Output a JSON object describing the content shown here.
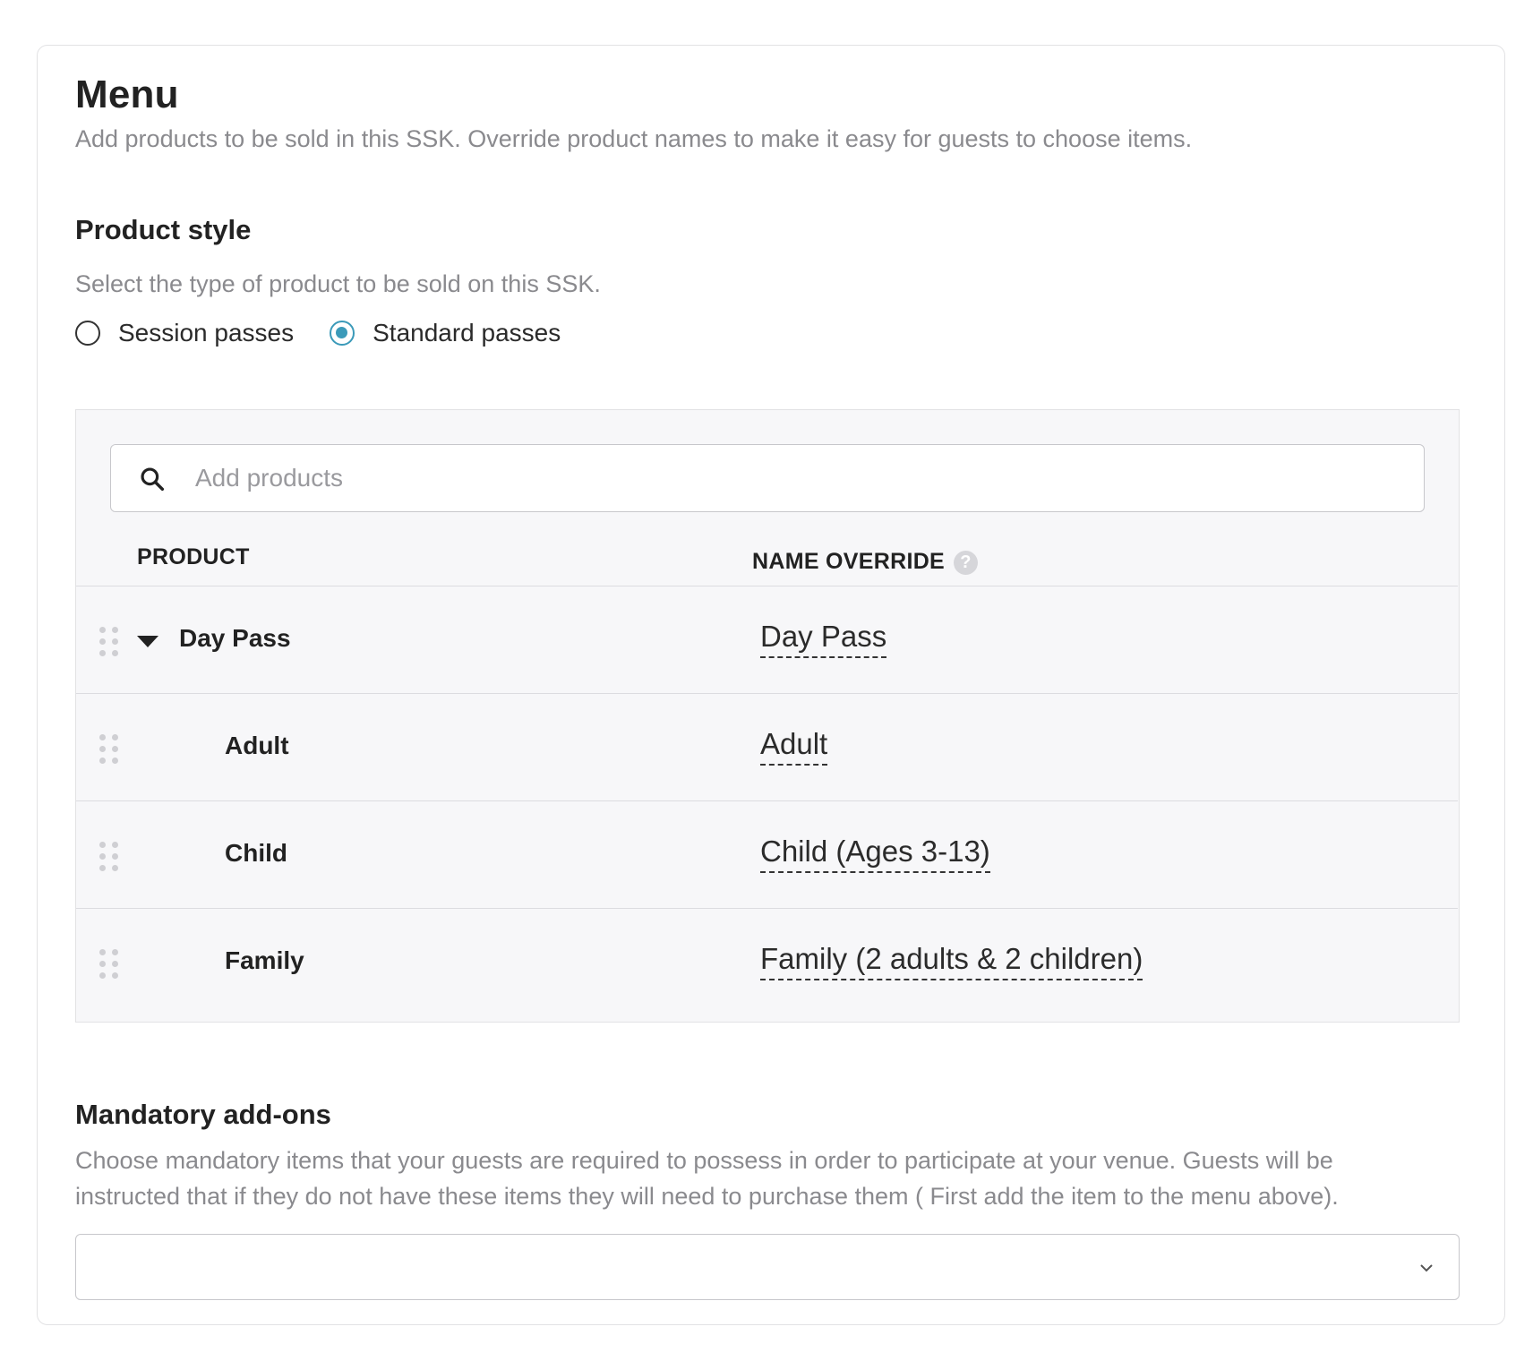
{
  "menu": {
    "title": "Menu",
    "subtitle": "Add products to be sold in this SSK. Override product names to make it easy for guests to choose items."
  },
  "product_style": {
    "title": "Product style",
    "subtitle": "Select the type of product to be sold on this SSK.",
    "options": [
      {
        "label": "Session passes",
        "selected": false
      },
      {
        "label": "Standard passes",
        "selected": true
      }
    ],
    "accent_color": "#3b9ab9"
  },
  "products": {
    "search_placeholder": "Add products",
    "columns": {
      "product": "PRODUCT",
      "name_override": "NAME OVERRIDE"
    },
    "rows": [
      {
        "product": "Day Pass",
        "override": "Day Pass",
        "expanded": true,
        "level": 0
      },
      {
        "product": "Adult",
        "override": "Adult",
        "level": 1
      },
      {
        "product": "Child",
        "override": "Child (Ages 3-13)",
        "level": 1
      },
      {
        "product": "Family",
        "override": "Family (2 adults & 2 children)",
        "level": 1
      }
    ]
  },
  "mandatory_addons": {
    "title": "Mandatory add-ons",
    "subtitle_line1": "Choose mandatory items that your guests are required to possess in order to participate at your venue. Guests will be",
    "subtitle_line2": "instructed that if they do not have these items they will need to purchase them ( First add the item to the menu above).",
    "selected_value": ""
  }
}
